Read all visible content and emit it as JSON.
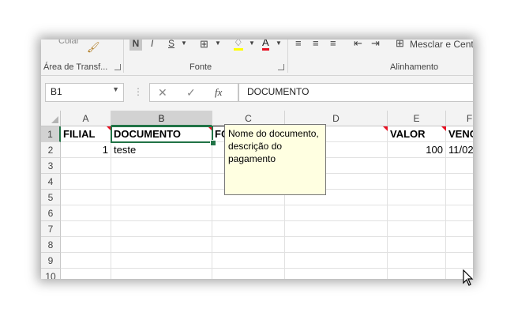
{
  "ribbon": {
    "paste_label": "Colar",
    "clipboard_label": "Área de Transf...",
    "font_group_label": "Fonte",
    "alignment_group_label": "Alinhamento",
    "bold_label": "N",
    "italic_label": "I",
    "underline_label": "S",
    "merge_label": "Mesclar e Cent"
  },
  "formula_bar": {
    "name_box": "B1",
    "formula": "DOCUMENTO",
    "fx_label": "fx"
  },
  "grid": {
    "columns": [
      "A",
      "B",
      "C",
      "D",
      "E",
      "F"
    ],
    "rows": [
      "1",
      "2",
      "3",
      "4",
      "5",
      "6",
      "7",
      "8",
      "9",
      "10"
    ],
    "row1": [
      "FILIAL",
      "DOCUMENTO",
      "FO",
      "",
      "VALOR",
      "VENC"
    ],
    "row2": [
      "1",
      "teste",
      "",
      "",
      "100",
      "11/02"
    ]
  },
  "comment": {
    "text": "Nome do documento, descrição do pagamento"
  },
  "colors": {
    "accent": "#217346",
    "comment_bg": "#ffffe1",
    "indicator": "#e81123"
  }
}
